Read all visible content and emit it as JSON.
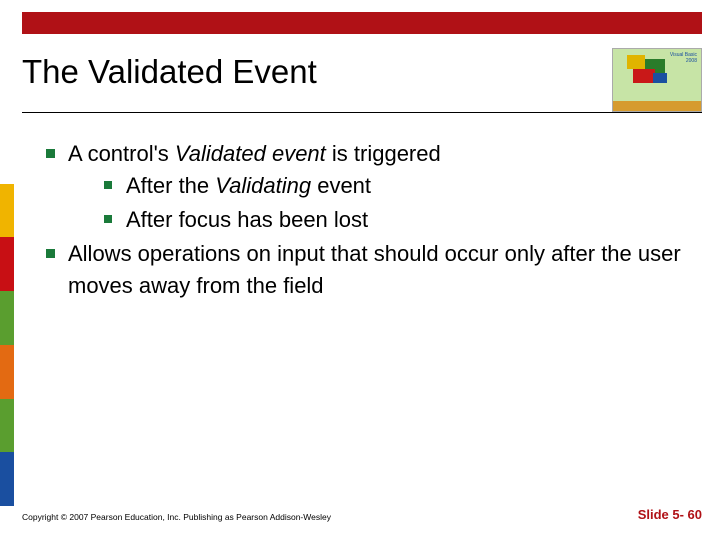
{
  "header": {
    "title": "The Validated Event"
  },
  "logo": {
    "line1": "Visual Basic",
    "line2": "2008"
  },
  "content": {
    "items": [
      {
        "pre": "A control's ",
        "em": "Validated event",
        "post": " is triggered",
        "sub": [
          {
            "pre": "After the ",
            "em": "Validating",
            "post": " event"
          },
          {
            "pre": "After focus has been lost",
            "em": "",
            "post": ""
          }
        ]
      },
      {
        "pre": "Allows operations on input that should occur only after the user moves away from the field",
        "em": "",
        "post": ""
      }
    ]
  },
  "footer": {
    "copyright": "Copyright © 2007 Pearson Education, Inc. Publishing as Pearson Addison-Wesley",
    "slide_number": "Slide 5- 60"
  }
}
